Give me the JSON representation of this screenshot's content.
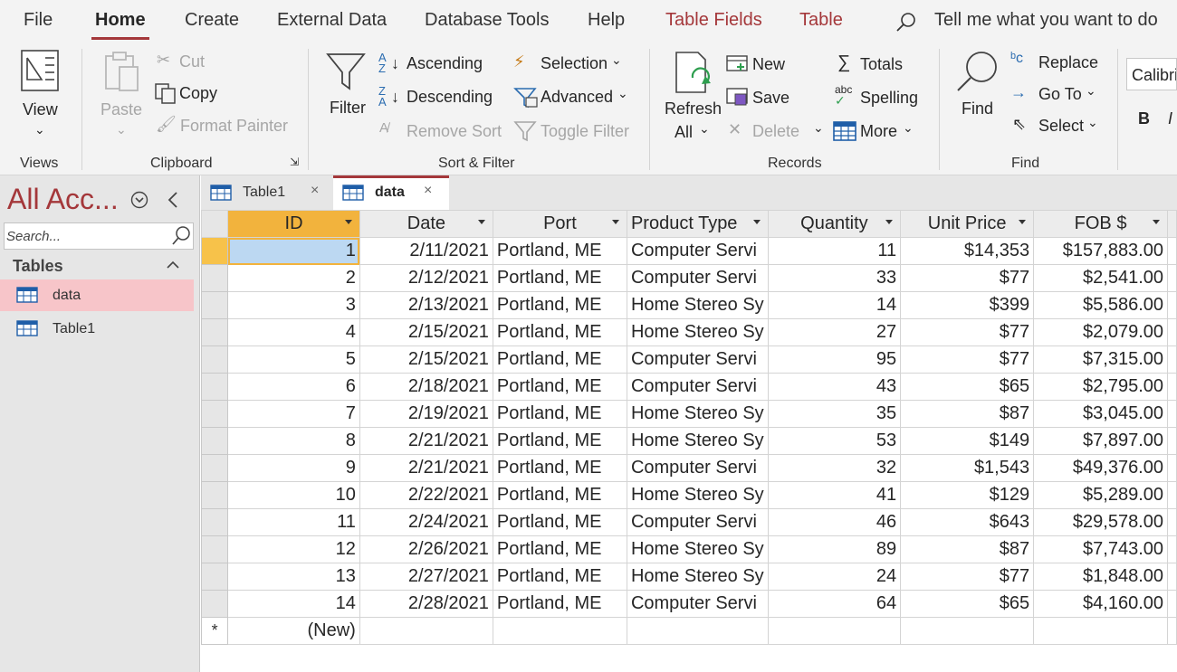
{
  "menu": {
    "tabs": [
      {
        "label": "File"
      },
      {
        "label": "Home"
      },
      {
        "label": "Create"
      },
      {
        "label": "External Data"
      },
      {
        "label": "Database Tools"
      },
      {
        "label": "Help"
      },
      {
        "label": "Table Fields"
      },
      {
        "label": "Table"
      }
    ],
    "active_tab": "Home",
    "tell_me": "Tell me what you want to do"
  },
  "ribbon": {
    "views": {
      "view": "View",
      "group": "Views"
    },
    "clipboard": {
      "paste": "Paste",
      "cut": "Cut",
      "copy": "Copy",
      "format_painter": "Format Painter",
      "group": "Clipboard"
    },
    "sort_filter": {
      "filter": "Filter",
      "ascending": "Ascending",
      "descending": "Descending",
      "remove_sort": "Remove Sort",
      "selection": "Selection",
      "advanced": "Advanced",
      "toggle_filter": "Toggle Filter",
      "group": "Sort & Filter"
    },
    "records": {
      "refresh_line1": "Refresh",
      "refresh_line2": "All",
      "new": "New",
      "save": "Save",
      "delete": "Delete",
      "totals": "Totals",
      "spelling": "Spelling",
      "more": "More",
      "group": "Records"
    },
    "find": {
      "find": "Find",
      "replace": "Replace",
      "go_to": "Go To",
      "select": "Select",
      "group": "Find"
    },
    "text_formatting": {
      "font": "Calibri",
      "bold": "B",
      "italic": "I"
    }
  },
  "nav": {
    "title": "All Acc...",
    "search_placeholder": "Search...",
    "section": "Tables",
    "items": [
      {
        "label": "data",
        "selected": true
      },
      {
        "label": "Table1",
        "selected": false
      }
    ]
  },
  "doc_tabs": [
    {
      "label": "Table1",
      "active": false
    },
    {
      "label": "data",
      "active": true
    }
  ],
  "datasheet": {
    "columns": [
      "ID",
      "Date",
      "Port",
      "Product Type",
      "Quantity",
      "Unit Price",
      "FOB $"
    ],
    "rows": [
      {
        "id": "1",
        "date": "2/11/2021",
        "port": "Portland, ME",
        "product": "Computer Servi",
        "qty": "11",
        "price": "$14,353",
        "fob": "$157,883.00"
      },
      {
        "id": "2",
        "date": "2/12/2021",
        "port": "Portland, ME",
        "product": "Computer Servi",
        "qty": "33",
        "price": "$77",
        "fob": "$2,541.00"
      },
      {
        "id": "3",
        "date": "2/13/2021",
        "port": "Portland, ME",
        "product": "Home Stereo Sy",
        "qty": "14",
        "price": "$399",
        "fob": "$5,586.00"
      },
      {
        "id": "4",
        "date": "2/15/2021",
        "port": "Portland, ME",
        "product": "Home Stereo Sy",
        "qty": "27",
        "price": "$77",
        "fob": "$2,079.00"
      },
      {
        "id": "5",
        "date": "2/15/2021",
        "port": "Portland, ME",
        "product": "Computer Servi",
        "qty": "95",
        "price": "$77",
        "fob": "$7,315.00"
      },
      {
        "id": "6",
        "date": "2/18/2021",
        "port": "Portland, ME",
        "product": "Computer Servi",
        "qty": "43",
        "price": "$65",
        "fob": "$2,795.00"
      },
      {
        "id": "7",
        "date": "2/19/2021",
        "port": "Portland, ME",
        "product": "Home Stereo Sy",
        "qty": "35",
        "price": "$87",
        "fob": "$3,045.00"
      },
      {
        "id": "8",
        "date": "2/21/2021",
        "port": "Portland, ME",
        "product": "Home Stereo Sy",
        "qty": "53",
        "price": "$149",
        "fob": "$7,897.00"
      },
      {
        "id": "9",
        "date": "2/21/2021",
        "port": "Portland, ME",
        "product": "Computer Servi",
        "qty": "32",
        "price": "$1,543",
        "fob": "$49,376.00"
      },
      {
        "id": "10",
        "date": "2/22/2021",
        "port": "Portland, ME",
        "product": "Home Stereo Sy",
        "qty": "41",
        "price": "$129",
        "fob": "$5,289.00"
      },
      {
        "id": "11",
        "date": "2/24/2021",
        "port": "Portland, ME",
        "product": "Computer Servi",
        "qty": "46",
        "price": "$643",
        "fob": "$29,578.00"
      },
      {
        "id": "12",
        "date": "2/26/2021",
        "port": "Portland, ME",
        "product": "Home Stereo Sy",
        "qty": "89",
        "price": "$87",
        "fob": "$7,743.00"
      },
      {
        "id": "13",
        "date": "2/27/2021",
        "port": "Portland, ME",
        "product": "Home Stereo Sy",
        "qty": "24",
        "price": "$77",
        "fob": "$1,848.00"
      },
      {
        "id": "14",
        "date": "2/28/2021",
        "port": "Portland, ME",
        "product": "Computer Servi",
        "qty": "64",
        "price": "$65",
        "fob": "$4,160.00"
      }
    ],
    "new_row_symbol": "*",
    "new_row_label": "(New)"
  },
  "colors": {
    "accent": "#a4373a",
    "selected_nav": "#f7c5c9",
    "current_record": "#f2b33d",
    "selected_cell": "#bcd8f2"
  }
}
